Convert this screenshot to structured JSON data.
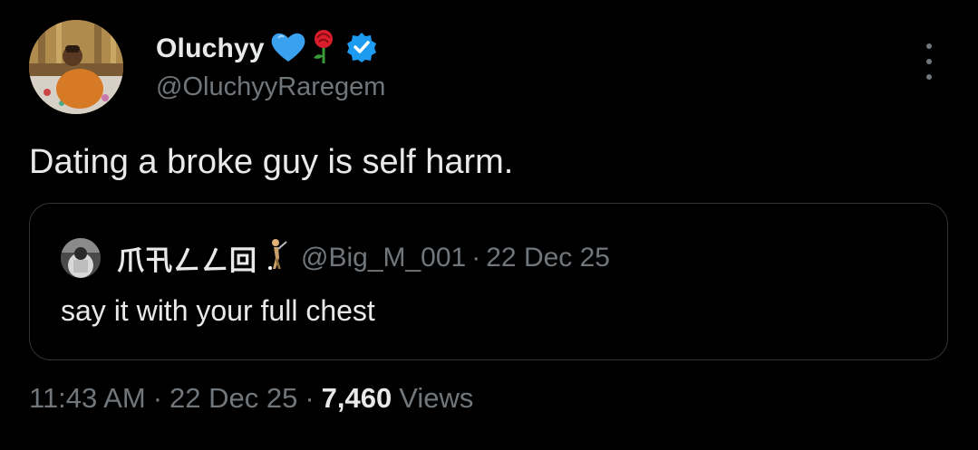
{
  "tweet": {
    "author": {
      "display_name": "Oluchyy",
      "emoji_1": "blue-heart-icon",
      "emoji_2": "rose-icon",
      "verified": "verified-badge-icon",
      "handle": "@OluchyyRaregem"
    },
    "text": "Dating a broke guy is self harm.",
    "quoted": {
      "display_name": "爪卂ㄥㄥ回",
      "emoji": "golfer-icon",
      "handle": "@Big_M_001",
      "separator": "·",
      "date": "22 Dec 25",
      "text": "say it with your full chest"
    },
    "meta": {
      "time": "11:43 AM",
      "separator": "·",
      "date": "22 Dec 25",
      "views_count": "7,460",
      "views_label": "Views"
    }
  },
  "colors": {
    "background": "#000000",
    "primary_text": "#e7e9ea",
    "secondary_text": "#71767b",
    "border": "#2f3336",
    "verified": "#1d9bf0"
  }
}
